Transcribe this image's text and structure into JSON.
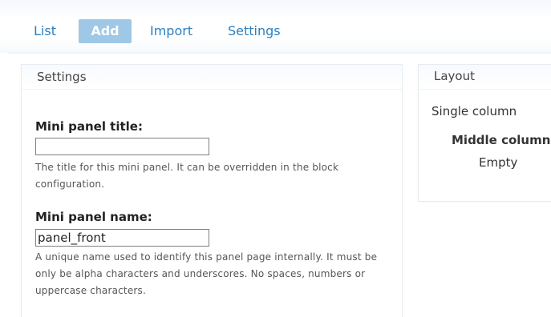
{
  "tabs": [
    {
      "label": "List",
      "active": false
    },
    {
      "label": "Add",
      "active": true
    },
    {
      "label": "Import",
      "active": false
    },
    {
      "label": "Settings",
      "active": false
    }
  ],
  "settings_panel": {
    "legend": "Settings",
    "title_field": {
      "label": "Mini panel title:",
      "value": "",
      "description": "The title for this mini panel. It can be overridden in the block configuration."
    },
    "name_field": {
      "label": "Mini panel name:",
      "value": "panel_front",
      "description": "A unique name used to identify this panel page internally. It must be only be alpha characters and underscores. No spaces, numbers or uppercase characters."
    }
  },
  "layout_panel": {
    "legend": "Layout",
    "layout_name": "Single column",
    "column_title": "Middle column",
    "column_content": "Empty"
  },
  "colors": {
    "tab_link": "#2b7fc0",
    "tab_active_bg": "#9ec8e6",
    "tab_active_text": "#ffffff"
  }
}
